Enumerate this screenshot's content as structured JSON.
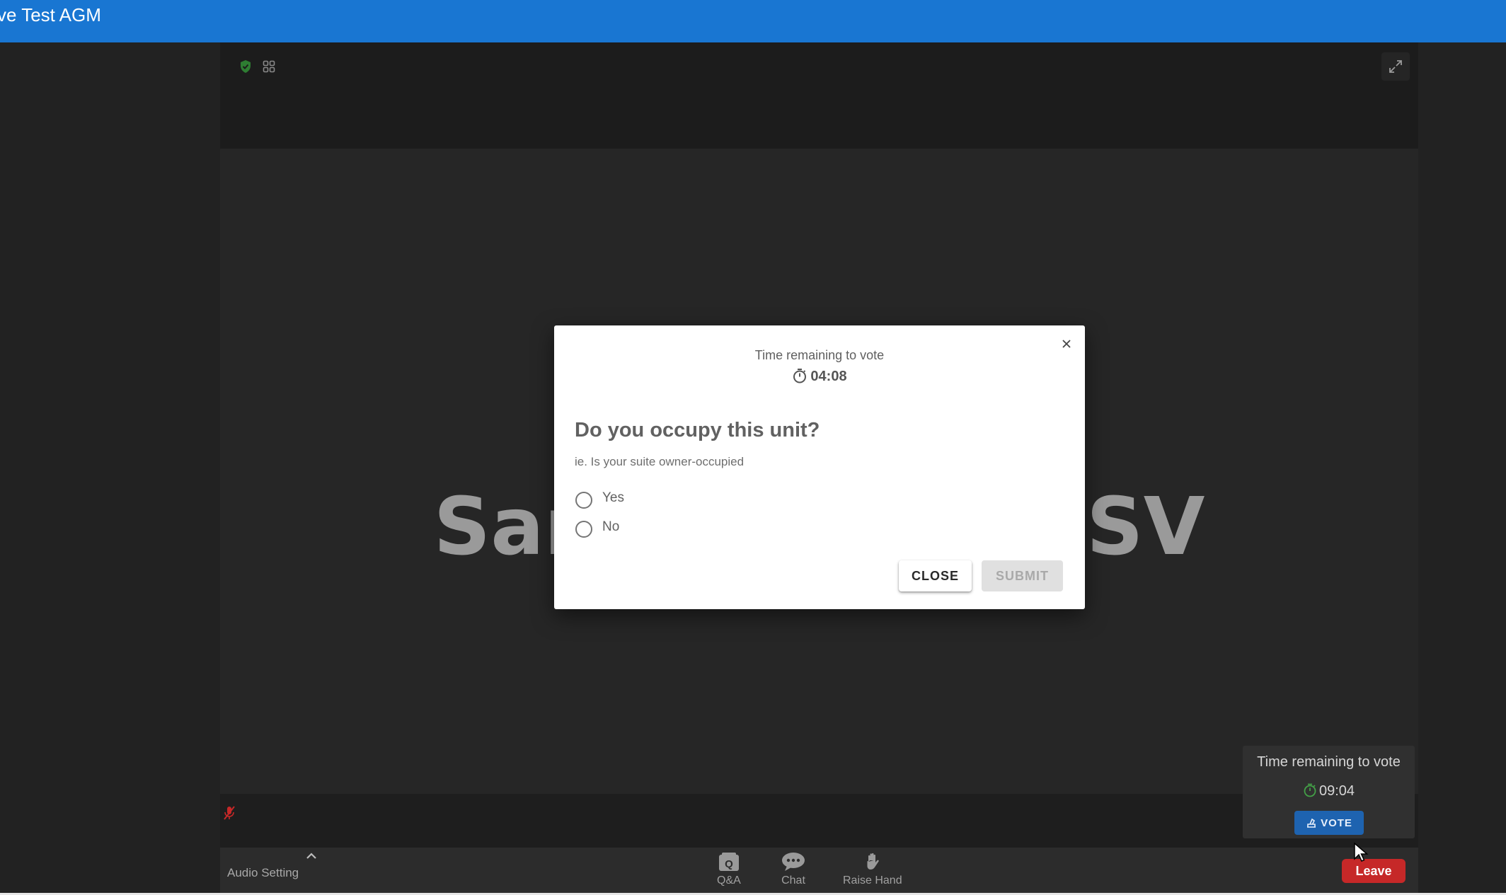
{
  "app": {
    "title": "ve Test AGM"
  },
  "presentation": {
    "text": "Sandpiper on ISV"
  },
  "footer": {
    "audio_setting": "Audio Setting",
    "controls": [
      {
        "label": "Q&A",
        "icon": "qa-icon",
        "glyph": "Q"
      },
      {
        "label": "Chat",
        "icon": "chat-icon"
      },
      {
        "label": "Raise Hand",
        "icon": "raise-hand-icon"
      }
    ],
    "leave_label": "Leave"
  },
  "vote_panel": {
    "label": "Time remaining to vote",
    "timer": "09:04",
    "vote_label": "VOTE"
  },
  "modal": {
    "time_label": "Time remaining to vote",
    "timer": "04:08",
    "question": "Do you occupy this unit?",
    "hint": "ie. Is your suite owner-occupied",
    "options": [
      "Yes",
      "No"
    ],
    "close_label": "CLOSE",
    "submit_label": "SUBMIT"
  },
  "colors": {
    "topbar": "#1976d2",
    "leave": "#c62828",
    "vote": "#1e63b0",
    "shield": "#2e7d32"
  }
}
